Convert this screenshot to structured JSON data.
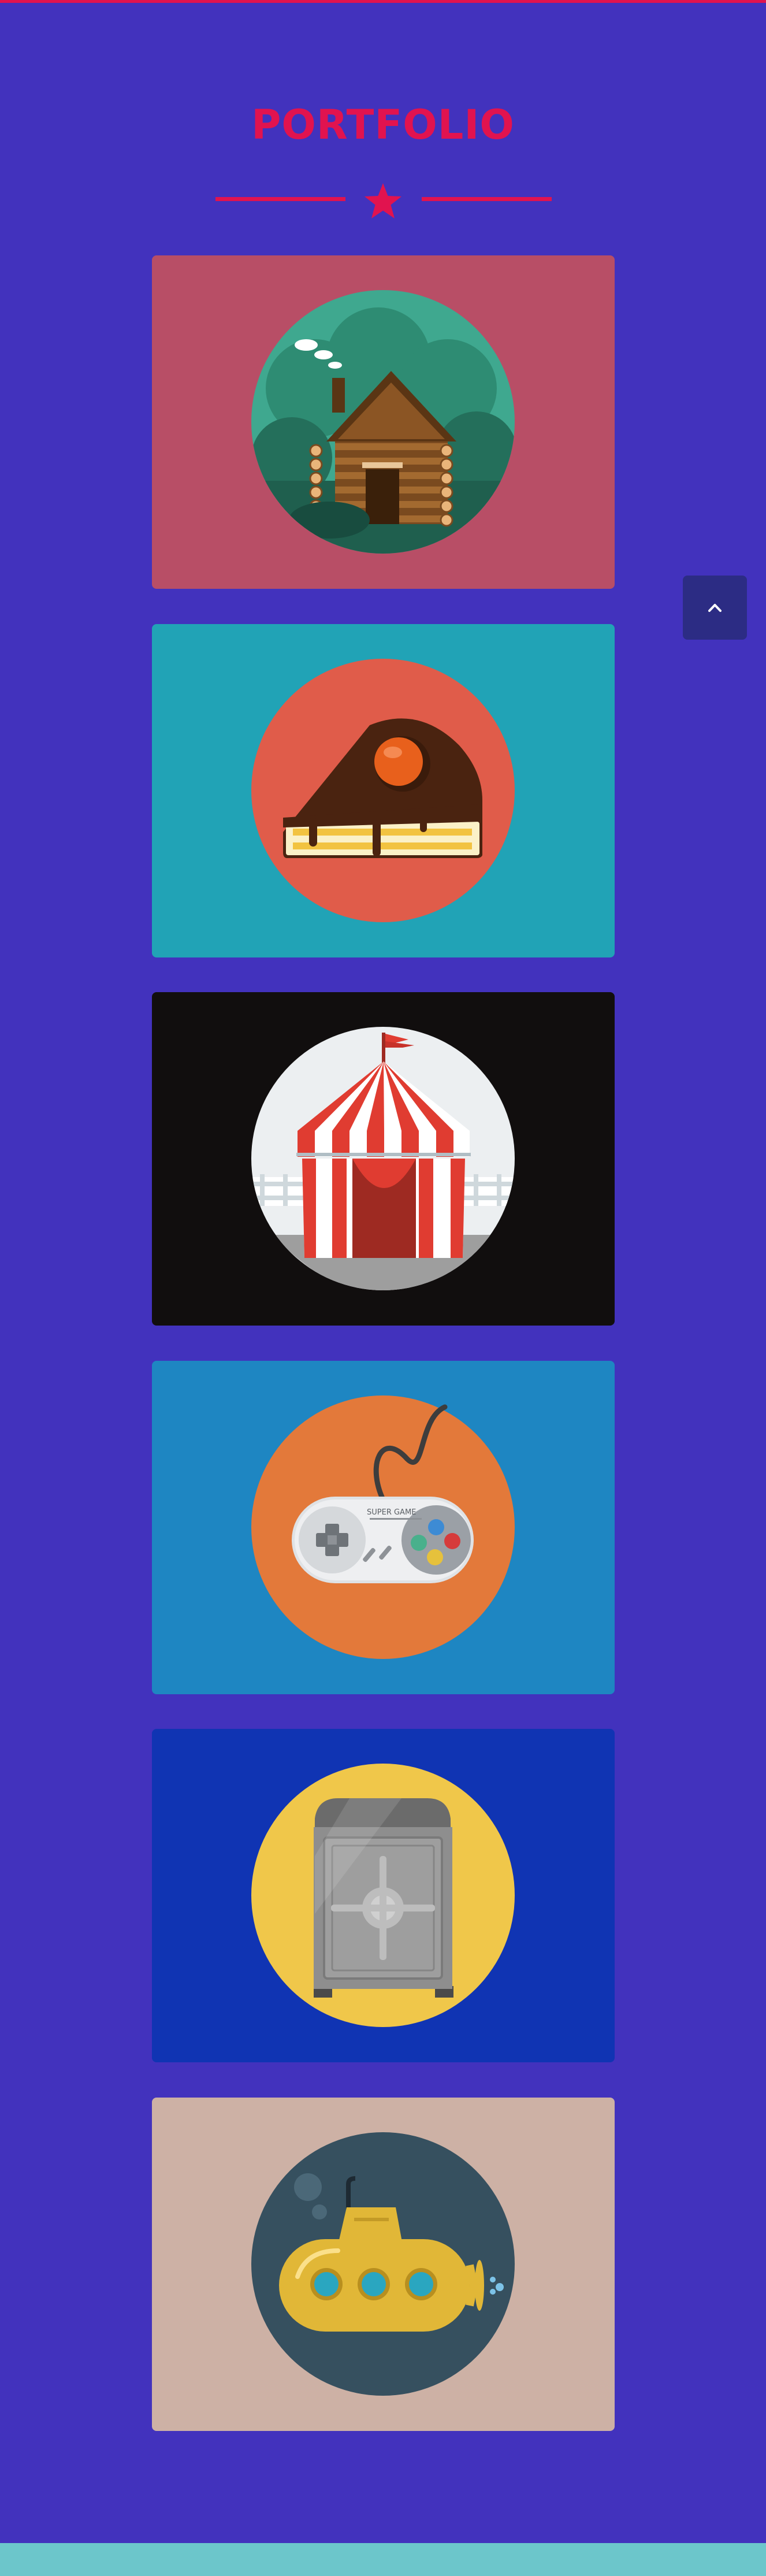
{
  "portfolio": {
    "title": "PORTFOLIO",
    "items": [
      {
        "icon": "cabin-icon",
        "bg": "#b84e66"
      },
      {
        "icon": "cake-icon",
        "bg": "#21a3b6"
      },
      {
        "icon": "circus-tent-icon",
        "bg": "#110e0e"
      },
      {
        "icon": "game-controller-icon",
        "bg": "#1e86c2"
      },
      {
        "icon": "safe-icon",
        "bg": "#1034b3"
      },
      {
        "icon": "submarine-icon",
        "bg": "#cdb1a5"
      }
    ],
    "controller_label": "SUPER GAME"
  },
  "colors": {
    "page_bg": "#4232bd",
    "accent": "#e1134f",
    "footer": "#6cc6cb",
    "scroll_button": "#2c2c84"
  },
  "scroll_top": {
    "icon": "chevron-up-icon"
  }
}
